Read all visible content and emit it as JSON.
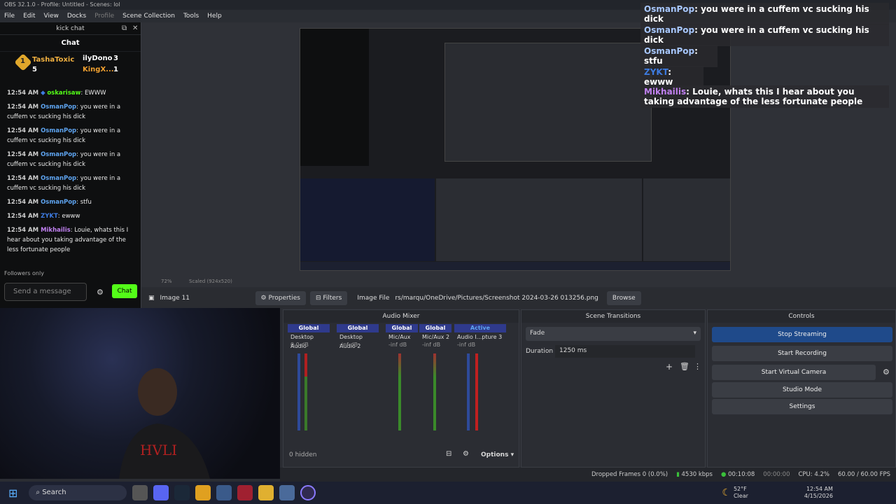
{
  "window": {
    "title": "OBS 32.1.0 - Profile: Untitled - Scenes: lol"
  },
  "menu": [
    "File",
    "Edit",
    "View",
    "Docks",
    "Profile",
    "Scene Collection",
    "Tools",
    "Help"
  ],
  "chat": {
    "dock_title": "kick chat",
    "title": "Chat",
    "leaderboard": [
      {
        "name": "TashaToxic",
        "count": "5"
      },
      {
        "name": "ilyDono",
        "count": "3"
      },
      {
        "name": "KingX...",
        "count": "1"
      }
    ],
    "messages": [
      {
        "time": "12:54 AM",
        "user": "oskarisaw",
        "text": "EWWW"
      },
      {
        "time": "12:54 AM",
        "user": "OsmanPop",
        "text": "you were in a cuffem vc sucking his dick"
      },
      {
        "time": "12:54 AM",
        "user": "OsmanPop",
        "text": "you were in a cuffem vc sucking his dick"
      },
      {
        "time": "12:54 AM",
        "user": "OsmanPop",
        "text": "you were in a cuffem vc sucking his dick"
      },
      {
        "time": "12:54 AM",
        "user": "OsmanPop",
        "text": "you were in a cuffem vc sucking his dick"
      },
      {
        "time": "12:54 AM",
        "user": "OsmanPop",
        "text": "stfu"
      },
      {
        "time": "12:54 AM",
        "user": "ZYKT",
        "text": "ewww"
      },
      {
        "time": "12:54 AM",
        "user": "Mikhailis",
        "text": "Louie, whats this I hear about you taking advantage of the less fortunate people"
      }
    ],
    "followers_only": "Followers only",
    "send_placeholder": "Send a message",
    "chat_button": "Chat"
  },
  "overlay": [
    {
      "user": "OsmanPop",
      "text": "you were in a cuffem vc sucking his dick"
    },
    {
      "user": "OsmanPop",
      "text": "you were in a cuffem vc sucking his dick"
    },
    {
      "user": "OsmanPop",
      "text": "stfu"
    },
    {
      "user": "ZYKT",
      "text": "ewww"
    },
    {
      "user": "Mikhailis",
      "text": "Louie, whats this I hear about you taking advantage of the less fortunate people"
    }
  ],
  "zoom": {
    "percent": "72%",
    "scaled": "Scaled (924x520)"
  },
  "source_bar": {
    "name": "Image 11",
    "properties": "Properties",
    "filters": "Filters",
    "image_file_label": "Image File",
    "path": "rs/marqu/OneDrive/Pictures/Screenshot 2024-03-26 013256.png",
    "browse": "Browse"
  },
  "mixer": {
    "title": "Audio Mixer",
    "channels": [
      {
        "tag": "Global",
        "name": "Desktop Audio",
        "db": "0.0 dB"
      },
      {
        "tag": "Global",
        "name": "Desktop Audio 2",
        "db": "-inf dB"
      },
      {
        "tag": "Global",
        "name": "Mic/Aux",
        "db": "-inf dB"
      },
      {
        "tag": "Global",
        "name": "Mic/Aux 2",
        "db": "-inf dB"
      },
      {
        "tag": "Active",
        "name": "Audio I...pture 3",
        "db": "-inf dB"
      }
    ],
    "hidden": "0 hidden",
    "options": "Options"
  },
  "transitions": {
    "title": "Scene Transitions",
    "type": "Fade",
    "duration_label": "Duration",
    "duration": "1250 ms"
  },
  "controls": {
    "title": "Controls",
    "buttons": [
      "Stop Streaming",
      "Start Recording",
      "Start Virtual Camera",
      "Studio Mode",
      "Settings"
    ]
  },
  "status": {
    "dropped": "Dropped Frames 0 (0.0%)",
    "bitrate": "4530 kbps",
    "stream_time": "00:10:08",
    "rec_time": "00:00:00",
    "cpu": "CPU: 4.2%",
    "fps": "60.00 / 60.00 FPS"
  },
  "taskbar": {
    "search": "Search",
    "temp": "52°F",
    "weather": "Clear",
    "time": "12:54 AM",
    "date": "4/15/2026"
  },
  "colors": {
    "kick_green": "#53fc18",
    "accent_blue": "#2f3a8c",
    "stream_blue": "#1f4a8a"
  }
}
